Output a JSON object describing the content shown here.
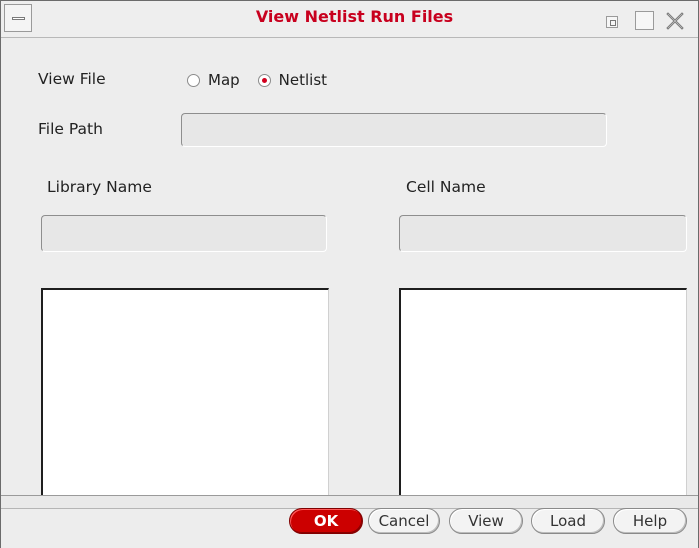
{
  "window": {
    "title": "View Netlist Run Files"
  },
  "view_file": {
    "label": "View File",
    "options": [
      {
        "label": "Map",
        "checked": false
      },
      {
        "label": "Netlist",
        "checked": true
      }
    ]
  },
  "file_path": {
    "label": "File Path",
    "value": ""
  },
  "library": {
    "label": "Library Name",
    "value": "",
    "items": []
  },
  "cell": {
    "label": "Cell Name",
    "value": "",
    "items": []
  },
  "buttons": {
    "ok": "OK",
    "cancel": "Cancel",
    "view": "View",
    "load": "Load",
    "help": "Help"
  },
  "colors": {
    "title": "#c8001e",
    "ok_button": "#cc0000",
    "radio_selected": "#d2001e"
  }
}
